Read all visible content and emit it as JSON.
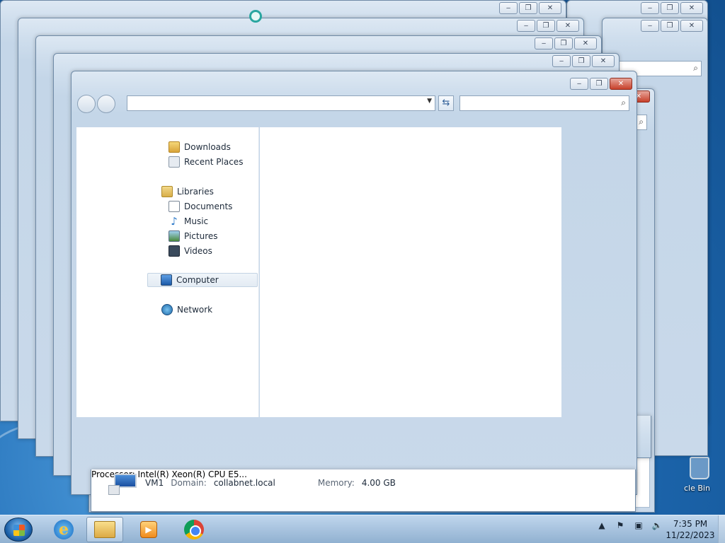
{
  "window": {
    "minimize_glyph": "‒",
    "maximize_glyph": "❐",
    "close_glyph": "✕",
    "dropdown_glyph": "▼",
    "refresh_glyph": "⇆",
    "search_glyph": "⌕"
  },
  "nav_pane": {
    "items": [
      {
        "label": "Downloads",
        "icon": "downloads-folder-icon"
      },
      {
        "label": "Recent Places",
        "icon": "recent-places-icon"
      },
      {
        "label": "Libraries",
        "icon": "libraries-icon"
      },
      {
        "label": "Documents",
        "icon": "documents-icon"
      },
      {
        "label": "Music",
        "icon": "music-icon"
      },
      {
        "label": "Pictures",
        "icon": "pictures-icon"
      },
      {
        "label": "Videos",
        "icon": "videos-icon"
      },
      {
        "label": "Computer",
        "icon": "computer-icon",
        "selected": true
      },
      {
        "label": "Network",
        "icon": "network-icon"
      }
    ]
  },
  "details": {
    "computer_name": "VM1",
    "domain_label": "Domain:",
    "domain_value": "collabnet.local",
    "memory_label": "Memory:",
    "memory_value": "4.00 GB",
    "processor_text": "Processor: Intel(R) Xeon(R) CPU E5..."
  },
  "desktop": {
    "recycle_bin_label": "cle Bin"
  },
  "taskbar": {
    "time": "7:35 PM",
    "date": "11/22/2023",
    "tray_chevron": "▲",
    "apps": [
      {
        "name": "internet-explorer",
        "glyph": "e"
      },
      {
        "name": "windows-explorer",
        "glyph": ""
      },
      {
        "name": "media-player",
        "glyph": "▶"
      },
      {
        "name": "chrome",
        "glyph": ""
      }
    ]
  },
  "colors": {
    "accent": "#2f5e98",
    "close_red": "#c8412b"
  }
}
